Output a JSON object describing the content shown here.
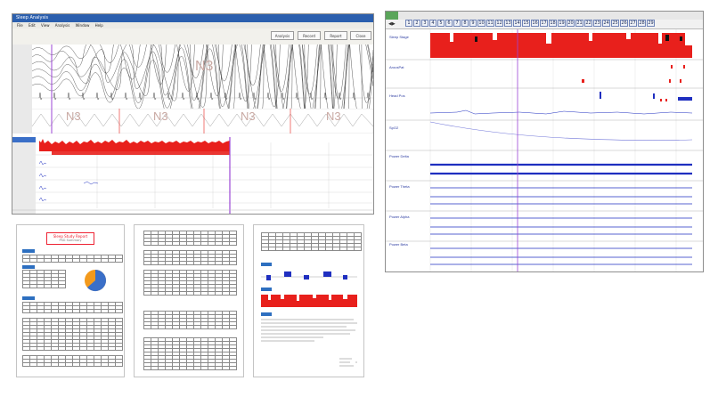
{
  "eeg_window": {
    "title": "Sleep Analysis",
    "menu": [
      "File",
      "Edit",
      "View",
      "Analysis",
      "Window",
      "Help"
    ],
    "stage_watermark": "N3",
    "hypno_stage_labels": [
      "N3",
      "N3",
      "N3",
      "N3"
    ],
    "toolbar_buttons": [
      "Analysis",
      "Record",
      "Report",
      "Close"
    ]
  },
  "trend_window": {
    "nav_numbers": [
      "1",
      "2",
      "3",
      "4",
      "5",
      "6",
      "7",
      "8",
      "9",
      "10",
      "11",
      "12",
      "13",
      "14",
      "15",
      "16",
      "17",
      "18",
      "19",
      "20",
      "21",
      "22",
      "23",
      "24",
      "25",
      "26",
      "27",
      "28",
      "29"
    ],
    "panel_labels": [
      "Sleep Stage",
      "ArousPat",
      "Head Pos",
      "SpO2",
      "Power Delta",
      "Power Theta",
      "Power Alpha",
      "Power Beta"
    ]
  },
  "report": {
    "title": "Sleep Study Report",
    "subtitle": "PSG Summary"
  },
  "colors": {
    "window_titlebar": "#2b5fae",
    "green_titlebar": "#5aa55a",
    "hypnogram_red": "#e8201c",
    "power_blue": "#1f2fc0",
    "purple_cursor": "#9b45d6",
    "pie_blue": "#3a6fc8",
    "pie_orange": "#f39a1c"
  }
}
